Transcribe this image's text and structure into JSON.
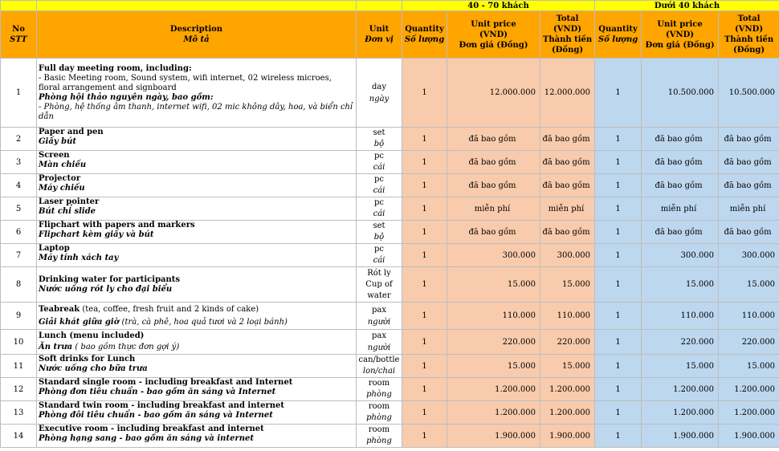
{
  "groups": {
    "g1": "40 - 70 khách",
    "g2": "Dưới 40 khách"
  },
  "header": {
    "no_en": "No",
    "no_vi": "STT",
    "desc_en": "Description",
    "desc_vi": "Mô tả",
    "unit_en": "Unit",
    "unit_vi": "Đơn vị",
    "qty_en": "Quantity",
    "qty_vi": "Số lượng",
    "price_en": "Unit price",
    "price_unit": "(VND)",
    "price_vi": "Đơn giá (Đồng)",
    "total_en": "Total",
    "total_unit": "(VND)",
    "total_vi1": "Thành tiền",
    "total_vi2": "(Đồng)"
  },
  "row1": {
    "no": "1",
    "title": "Full day meeting room, including:",
    "line1": "- Basic Meeting room, Sound system, wifi internet, 02 wireless microes, floral arrangement and signboard",
    "title_vi": "Phòng hội thảo nguyên ngày, bao gồm:",
    "line2": "- Phòng, hệ thống âm thanh, internet wifi, 02 mic không dây, hoa, và biển chỉ dẫn",
    "unit_en": "day",
    "unit_vi": "ngày",
    "q1": "1",
    "p1": "12.000.000",
    "t1": "12.000.000",
    "q2": "1",
    "p2": "10.500.000",
    "t2": "10.500.000"
  },
  "rows": [
    {
      "no": "2",
      "en": "Paper and pen",
      "vi": "Giấy bút",
      "u1": "set",
      "u2": "bộ",
      "q1": "1",
      "p1": "đã bao gồm",
      "t1": "đã bao gồm",
      "q2": "1",
      "p2": "đã bao gồm",
      "t2": "đã bao gồm"
    },
    {
      "no": "3",
      "en": "Screen",
      "vi": "Màn chiếu",
      "u1": "pc",
      "u2": "cái",
      "q1": "1",
      "p1": "đã bao gồm",
      "t1": "đã bao gồm",
      "q2": "1",
      "p2": "đã bao gồm",
      "t2": "đã bao gồm"
    },
    {
      "no": "4",
      "en": "Projector",
      "vi": "Máy chiếu",
      "u1": "pc",
      "u2": "cái",
      "q1": "1",
      "p1": "đã bao gồm",
      "t1": "đã bao gồm",
      "q2": "1",
      "p2": "đã bao gồm",
      "t2": "đã bao gồm"
    },
    {
      "no": "5",
      "en": "Laser pointer",
      "vi": "Bút chỉ slide",
      "u1": "pc",
      "u2": "cái",
      "q1": "1",
      "p1": "miễn phí",
      "t1": "miễn phí",
      "q2": "1",
      "p2": "miễn phí",
      "t2": "miễn phí"
    },
    {
      "no": "6",
      "en": "Flipchart with papers and markers",
      "vi": "Flipchart kèm giấy và bút",
      "u1": "set",
      "u2": "bộ",
      "q1": "1",
      "p1": "đã bao gồm",
      "t1": "đã bao gồm",
      "q2": "1",
      "p2": "đã bao gồm",
      "t2": "đã bao gồm"
    },
    {
      "no": "7",
      "en": "Laptop",
      "vi": "Máy tính xách tay",
      "u1": "pc",
      "u2": "cái",
      "q1": "1",
      "p1": "300.000",
      "t1": "300.000",
      "q2": "1",
      "p2": "300.000",
      "t2": "300.000"
    }
  ],
  "row8": {
    "no": "8",
    "en": "Drinking water for participants",
    "vi": "Nước uống rót ly cho đại biểu",
    "u1": "Rót ly",
    "u2": "Cup of",
    "u3": "water",
    "q1": "1",
    "p1": "15.000",
    "t1": "15.000",
    "q2": "1",
    "p2": "15.000",
    "t2": "15.000"
  },
  "row9": {
    "no": "9",
    "en": "Teabreak",
    "en_rest": " (tea, coffee, fresh fruit and 2 kinds of cake)",
    "vi": "Giải khát giữa giờ",
    "vi_rest": " (trà, cà phê, hoa quả tươi và 2 loại bánh)",
    "u1": "pax",
    "u2": "người",
    "q1": "1",
    "p1": "110.000",
    "t1": "110.000",
    "q2": "1",
    "p2": "110.000",
    "t2": "110.000"
  },
  "row10": {
    "no": "10",
    "en": "Lunch (menu included)",
    "vi": "Ăn trưa",
    "vi_rest": " ( bao gồm thực đơn gợi ý)",
    "u1": "pax",
    "u2": "người",
    "q1": "1",
    "p1": "220.000",
    "t1": "220.000",
    "q2": "1",
    "p2": "220.000",
    "t2": "220.000"
  },
  "rows_b": [
    {
      "no": "11",
      "en": "Soft drinks for Lunch",
      "vi": "Nước uống cho bữa trưa",
      "u1": "can/bottle",
      "u2": "lon/chai",
      "q1": "1",
      "p1": "15.000",
      "t1": "15.000",
      "q2": "1",
      "p2": "15.000",
      "t2": "15.000"
    },
    {
      "no": "12",
      "en": "Standard single room - including breakfast and Internet",
      "vi": "Phòng đơn tiêu chuẩn - bao gồm ăn sáng và Internet",
      "u1": "room",
      "u2": "phòng",
      "q1": "1",
      "p1": "1.200.000",
      "t1": "1.200.000",
      "q2": "1",
      "p2": "1.200.000",
      "t2": "1.200.000"
    },
    {
      "no": "13",
      "en": "Standard twin room - including breakfast and internet",
      "vi": "Phòng đôi tiêu chuẩn - bao gồm ăn sáng và Internet",
      "u1": "room",
      "u2": "phòng",
      "q1": "1",
      "p1": "1.200.000",
      "t1": "1.200.000",
      "q2": "1",
      "p2": "1.200.000",
      "t2": "1.200.000"
    },
    {
      "no": "14",
      "en": "Executive room - including breakfast and internet",
      "vi": "Phòng hạng sang - bao gồm ăn sáng và internet",
      "u1": "room",
      "u2": "phòng",
      "q1": "1",
      "p1": "1.900.000",
      "t1": "1.900.000",
      "q2": "1",
      "p2": "1.900.000",
      "t2": "1.900.000"
    }
  ]
}
